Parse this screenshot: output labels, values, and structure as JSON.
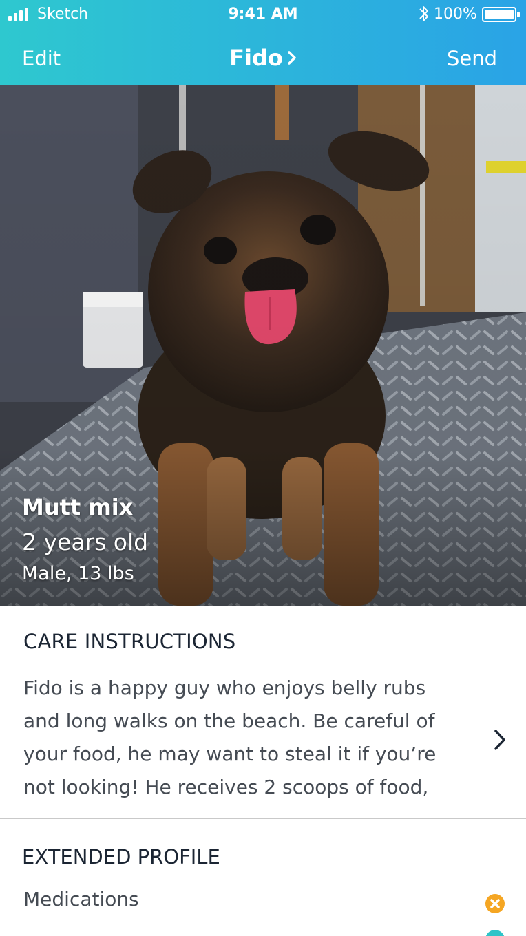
{
  "status_bar": {
    "carrier": "Sketch",
    "time": "9:41 AM",
    "battery_percent": "100%",
    "battery_level": 1.0,
    "icons": [
      "signal-icon",
      "bluetooth-icon",
      "battery-icon"
    ]
  },
  "nav": {
    "left_label": "Edit",
    "title": "Fido",
    "right_label": "Send",
    "title_icon": "chevron-right-icon"
  },
  "colors": {
    "header_gradient_start": "#2ec8cf",
    "header_gradient_end": "#2aa3e6",
    "warning_orange": "#f5a623",
    "ok_teal": "#2ec4c8"
  },
  "pet": {
    "breed": "Mutt mix",
    "age": "2 years old",
    "sex_weight": "Male, 13 lbs"
  },
  "care": {
    "heading": "CARE INSTRUCTIONS",
    "text": "Fido is a happy guy who enjoys belly rubs and long walks on the beach. Be careful of your food, he may want to steal it if you’re not looking! He receives 2 scoops of food,",
    "icon": "chevron-right-icon"
  },
  "extended_profile": {
    "heading": "EXTENDED PROFILE",
    "rows": [
      {
        "label": "Medications",
        "status_icon": "close-circle-icon",
        "status_color": "#f5a623"
      },
      {
        "label": "",
        "status_icon": "check-circle-icon",
        "status_color": "#2ec4c8"
      }
    ]
  }
}
